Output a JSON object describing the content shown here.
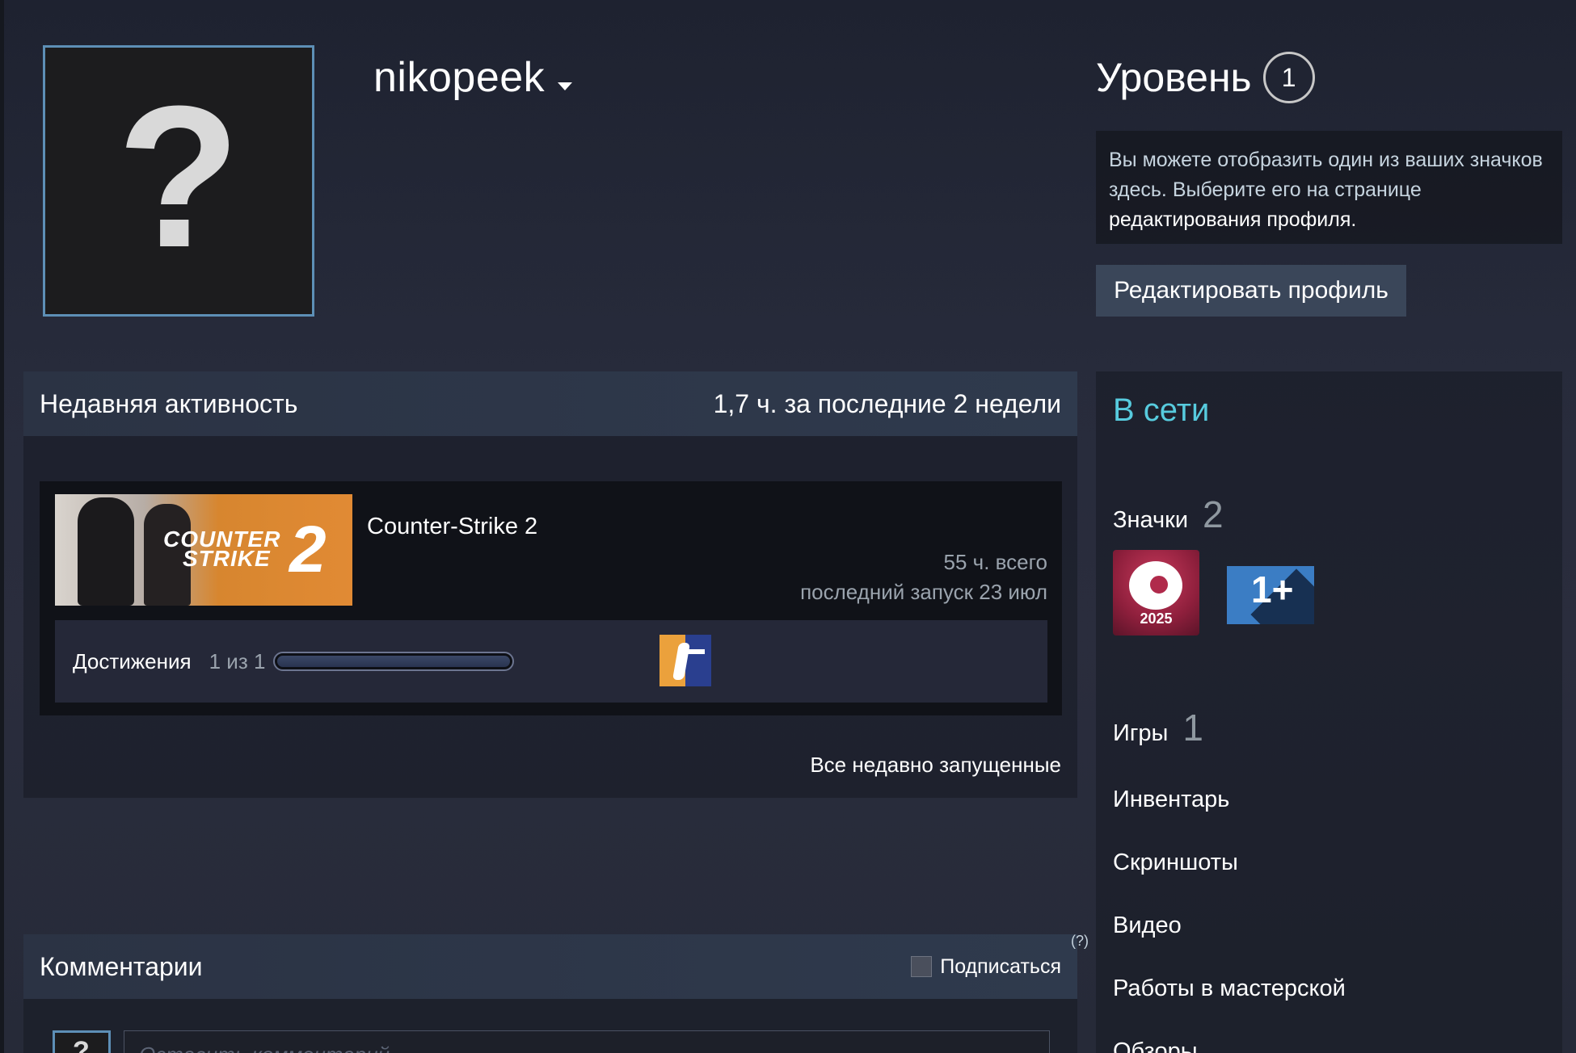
{
  "profile": {
    "username": "nikopeek",
    "avatar_glyph": "?",
    "level_label": "Уровень",
    "level": "1",
    "badge_hint_text": "Вы можете отобразить один из ваших значков здесь. Выберите его на странице ",
    "badge_hint_link": "редактирования профиля.",
    "edit_button": "Редактировать профиль"
  },
  "activity": {
    "title": "Недавняя активность",
    "summary": "1,7 ч. за последние 2 недели",
    "game": {
      "name": "Counter-Strike 2",
      "capsule_text_line1": "COUNTER",
      "capsule_text_line2": "STRIKE",
      "capsule_number": "2",
      "total": "55 ч. всего",
      "last_played": "последний запуск 23 июл",
      "achievements_label": "Достижения",
      "achievements_count": "1 из 1",
      "achievements_progress": 1.0
    },
    "all_recent": "Все недавно запущенные"
  },
  "comments": {
    "title": "Комментарии",
    "subscribe": "Подписаться",
    "help": "(?)",
    "placeholder": "Оставить комментарий"
  },
  "sidebar": {
    "status": "В сети",
    "badges_label": "Значки",
    "badges_count": "2",
    "badge_year": "2025",
    "badge_years_label": "1+",
    "games_label": "Игры",
    "games_count": "1",
    "links": [
      "Инвентарь",
      "Скриншоты",
      "Видео",
      "Работы в мастерской",
      "Обзоры"
    ]
  },
  "colors": {
    "status_online": "#57cbde",
    "avatar_border": "#5d8fb6",
    "button_bg": "#3a4659"
  }
}
